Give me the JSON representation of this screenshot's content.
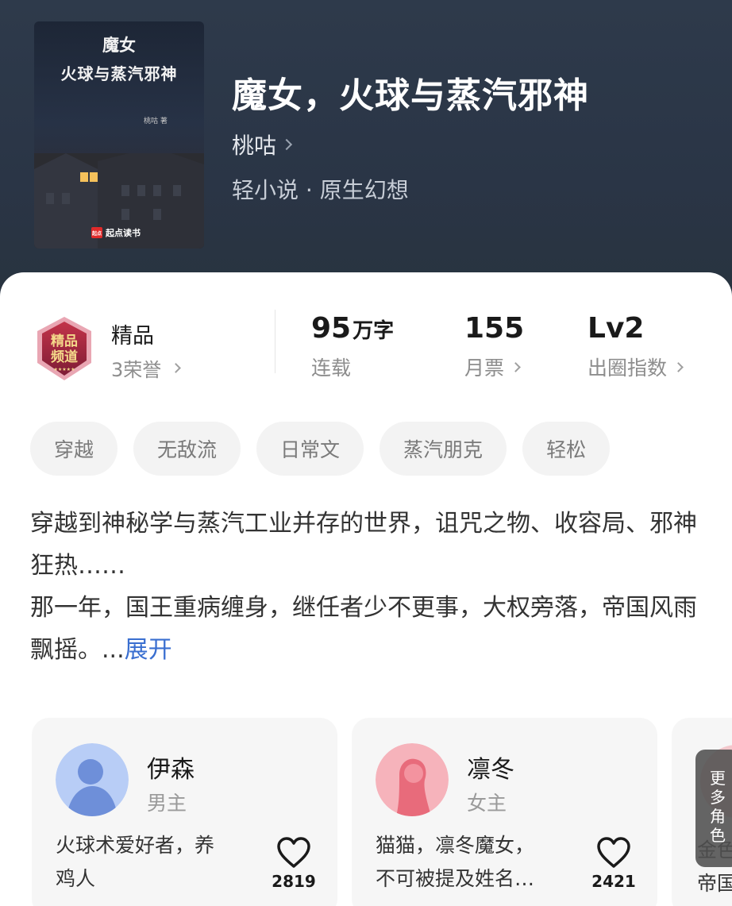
{
  "header": {
    "cover": {
      "title_line1": "魔女",
      "title_line2": "火球与蒸汽邪神",
      "author": "桃咕 著",
      "publisher": "起点读书",
      "publisher_mark": "起点"
    },
    "title": "魔女，火球与蒸汽邪神",
    "author": "桃咕",
    "genre": "轻小说 · 原生幻想"
  },
  "stats": {
    "honor": {
      "label": "精品",
      "count": "3荣誉",
      "badge_line1": "精品",
      "badge_line2": "频道"
    },
    "words": {
      "value": "95",
      "unit": "万字",
      "label": "连载"
    },
    "tickets": {
      "value": "155",
      "label": "月票"
    },
    "circle": {
      "value": "Lv2",
      "label": "出圈指数"
    }
  },
  "tags": [
    "穿越",
    "无敌流",
    "日常文",
    "蒸汽朋克",
    "轻松"
  ],
  "synopsis": {
    "line1": "穿越到神秘学与蒸汽工业并存的世界，诅咒之物、收容局、邪神狂热……",
    "line2": "那一年，国王重病缠身，继任者少不更事，大权旁落，帝国风雨飘摇。...",
    "expand": "展开"
  },
  "characters": [
    {
      "name": "伊森",
      "role": "男主",
      "desc": "火球术爱好者，养\n鸡人",
      "likes": "2819"
    },
    {
      "name": "凛冬",
      "role": "女主",
      "desc": "猫猫，凛冬魔女，\n不可被提及姓名…",
      "likes": "2421"
    }
  ],
  "more": {
    "label": "更\n多\n角\n色",
    "peek_desc": "金色\n帝国"
  },
  "colors": {
    "link": "#3a6fd0",
    "header_bg": "#2b3748"
  }
}
